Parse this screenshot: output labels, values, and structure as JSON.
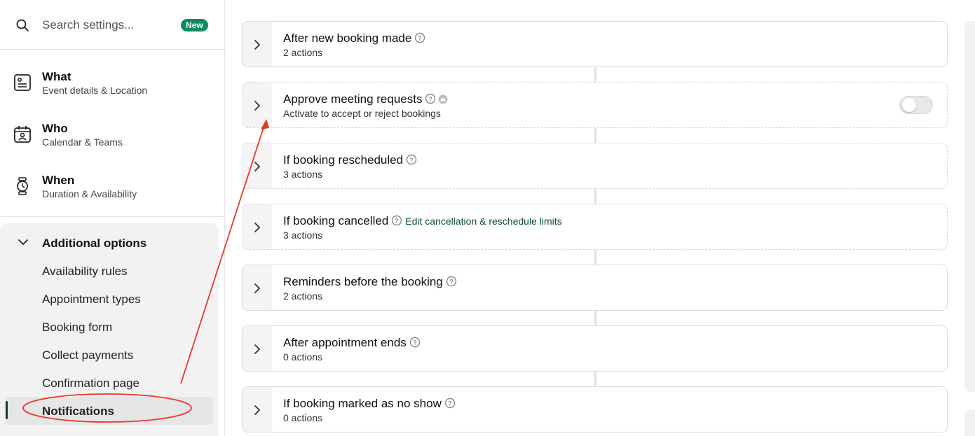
{
  "search": {
    "placeholder": "Search settings...",
    "badge": "New"
  },
  "nav": [
    {
      "title": "What",
      "subtitle": "Event details & Location",
      "icon": "event-details-icon"
    },
    {
      "title": "Who",
      "subtitle": "Calendar & Teams",
      "icon": "calendar-person-icon"
    },
    {
      "title": "When",
      "subtitle": "Duration & Availability",
      "icon": "watch-icon"
    }
  ],
  "additional": {
    "label": "Additional options",
    "items": [
      "Availability rules",
      "Appointment types",
      "Booking form",
      "Collect payments",
      "Confirmation page",
      "Notifications"
    ],
    "active": "Notifications"
  },
  "cards": [
    {
      "title": "After new booking made",
      "subtitle": "2 actions"
    },
    {
      "title": "Approve meeting requests",
      "subtitle": "Activate to accept or reject bookings",
      "toggle": false
    },
    {
      "title": "If booking rescheduled",
      "subtitle": "3 actions"
    },
    {
      "title": "If booking cancelled",
      "subtitle": "3 actions",
      "link": "Edit cancellation & reschedule limits"
    },
    {
      "title": "Reminders before the booking",
      "subtitle": "2 actions"
    },
    {
      "title": "After appointment ends",
      "subtitle": "0 actions"
    },
    {
      "title": "If booking marked as no show",
      "subtitle": "0 actions"
    }
  ],
  "colors": {
    "accent": "#0b3b2f",
    "badge": "#0d8a5f",
    "annotation": "#e8382b"
  }
}
